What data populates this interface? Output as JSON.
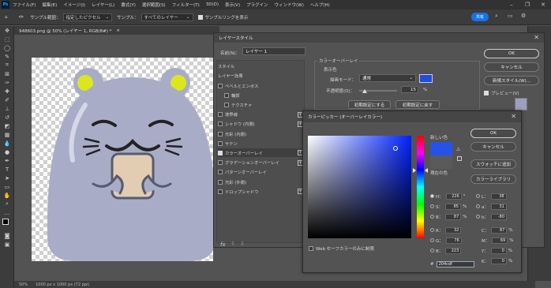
{
  "menu": {
    "logo": "Ps",
    "items": [
      "ファイル(F)",
      "編集(E)",
      "イメージ(I)",
      "レイヤー(L)",
      "書式(Y)",
      "選択範囲(S)",
      "フィルター(T)",
      "3D(D)",
      "表示(V)",
      "プラグイン",
      "ウィンドウ(W)",
      "ヘルプ(H)"
    ]
  },
  "options": {
    "sample_size_label": "サンプル範囲：",
    "sample_size_value": "指定したピクセル",
    "sample_label": "サンプル：",
    "sample_value": "すべてのレイヤー",
    "show_ring_label": "サンプルリングを表示",
    "share_label": "共有"
  },
  "document": {
    "tab": "948603.png @ 50% (レイヤー 1, RGB/8#) *",
    "status": "50%　　1000 px x 1000 px (72 ppi)"
  },
  "layer_style": {
    "title": "レイヤースタイル",
    "name_label": "名前(N)：",
    "name_value": "レイヤー 1",
    "styles_header": "スタイル",
    "blend_options": "レイヤー効果",
    "items": [
      {
        "label": "ベベルとエンボス",
        "checked": false,
        "plus": false,
        "indent": false
      },
      {
        "label": "輪郭",
        "checked": false,
        "plus": false,
        "indent": true
      },
      {
        "label": "テクスチャ",
        "checked": false,
        "plus": false,
        "indent": true
      },
      {
        "label": "境界線",
        "checked": false,
        "plus": true,
        "indent": false
      },
      {
        "label": "シャドウ (内側)",
        "checked": false,
        "plus": true,
        "indent": false
      },
      {
        "label": "光彩 (内側)",
        "checked": false,
        "plus": false,
        "indent": false
      },
      {
        "label": "サテン",
        "checked": false,
        "plus": false,
        "indent": false
      },
      {
        "label": "カラーオーバーレイ",
        "checked": true,
        "plus": true,
        "indent": false
      },
      {
        "label": "グラデーションオーバーレイ",
        "checked": false,
        "plus": true,
        "indent": false
      },
      {
        "label": "パターンオーバーレイ",
        "checked": false,
        "plus": false,
        "indent": false
      },
      {
        "label": "光彩 (外側)",
        "checked": false,
        "plus": false,
        "indent": false
      },
      {
        "label": "ドロップシャドウ",
        "checked": false,
        "plus": true,
        "indent": false
      }
    ],
    "fx_label": "fx",
    "overlay_header": "カラーオーバーレイ",
    "overlay_sub": "表示色",
    "blend_mode_label": "描画モード：",
    "blend_mode_value": "通常",
    "opacity_label": "不透明度(O)：",
    "opacity_value": "15",
    "opacity_unit": "%",
    "reset_default": "初期設定にする",
    "restore_default": "初期設定に戻す",
    "ok": "OK",
    "cancel": "キャンセル",
    "new_style": "新規スタイル(W)...",
    "preview": "プレビュー(V)",
    "overlay_color": "#204cdf"
  },
  "color_picker": {
    "title": "カラーピッカー (オーバーレイカラー)",
    "new_label": "新しい色",
    "current_label": "現在の色",
    "new_color": "#2652e8",
    "current_color": "#5a5a5a",
    "ok": "OK",
    "cancel": "キャンセル",
    "add_swatch": "スウォッチに追加",
    "color_library": "カラーライブラリ",
    "web_only": "Web セーフカラーのみに制限",
    "fields": {
      "H": {
        "label": "H：",
        "value": "226",
        "unit": "°"
      },
      "S": {
        "label": "S：",
        "value": "85",
        "unit": "%"
      },
      "Bv": {
        "label": "B：",
        "value": "87",
        "unit": "%"
      },
      "R": {
        "label": "R：",
        "value": "32",
        "unit": ""
      },
      "G": {
        "label": "G：",
        "value": "76",
        "unit": ""
      },
      "Bb": {
        "label": "B：",
        "value": "223",
        "unit": ""
      },
      "L": {
        "label": "L：",
        "value": "38",
        "unit": ""
      },
      "a": {
        "label": "a：",
        "value": "31",
        "unit": ""
      },
      "b": {
        "label": "b：",
        "value": "-80",
        "unit": ""
      },
      "C": {
        "label": "C：",
        "value": "87",
        "unit": "%"
      },
      "M": {
        "label": "M：",
        "value": "69",
        "unit": "%"
      },
      "Y": {
        "label": "Y：",
        "value": "0",
        "unit": "%"
      },
      "K": {
        "label": "K：",
        "value": "0",
        "unit": "%"
      }
    },
    "hex_label": "#",
    "hex_value": "204cdf"
  }
}
